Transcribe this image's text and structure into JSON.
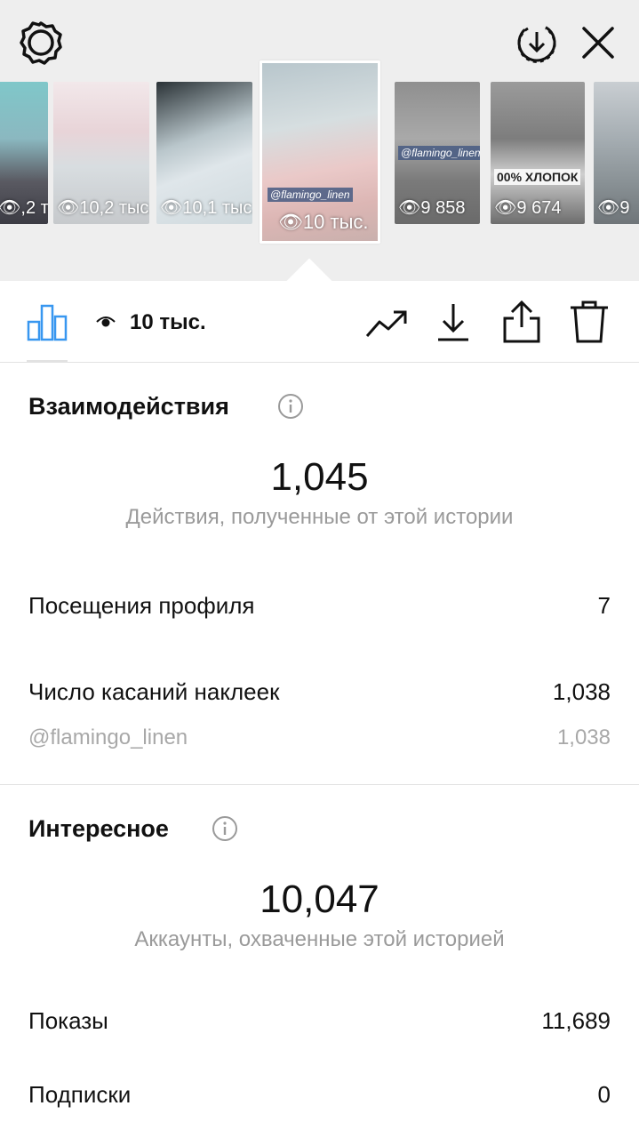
{
  "thumbnails": [
    {
      "views": ",2 тыс.",
      "caption": ""
    },
    {
      "views": "10,2 тыс.",
      "caption": ""
    },
    {
      "views": "10,1 тыс.",
      "caption": ""
    },
    {
      "views": "10 тыс.",
      "caption": "@flamingo_linen"
    },
    {
      "views": "9 858",
      "caption": "@flamingo_linen"
    },
    {
      "views": "9 674",
      "caption": "00% ХЛОПОК"
    },
    {
      "views": "9",
      "caption": ""
    }
  ],
  "toolbar": {
    "views_count": "10 тыс."
  },
  "interactions": {
    "title": "Взаимодействия",
    "total": "1,045",
    "total_desc": "Действия, полученные от этой истории",
    "rows": [
      {
        "label": "Посещения профиля",
        "value": "7"
      },
      {
        "label": "Число касаний наклеек",
        "value": "1,038"
      },
      {
        "label": "@flamingo_linen",
        "value": "1,038"
      }
    ]
  },
  "discovery": {
    "title": "Интересное",
    "total": "10,047",
    "total_desc": "Аккаунты, охваченные этой историей",
    "rows": [
      {
        "label": "Показы",
        "value": "11,689"
      },
      {
        "label": "Подписки",
        "value": "0"
      }
    ]
  },
  "colors": {
    "accent_blue": "#3897f0",
    "top_bg": "#eeeeee",
    "muted_text": "#9a9a9a"
  }
}
